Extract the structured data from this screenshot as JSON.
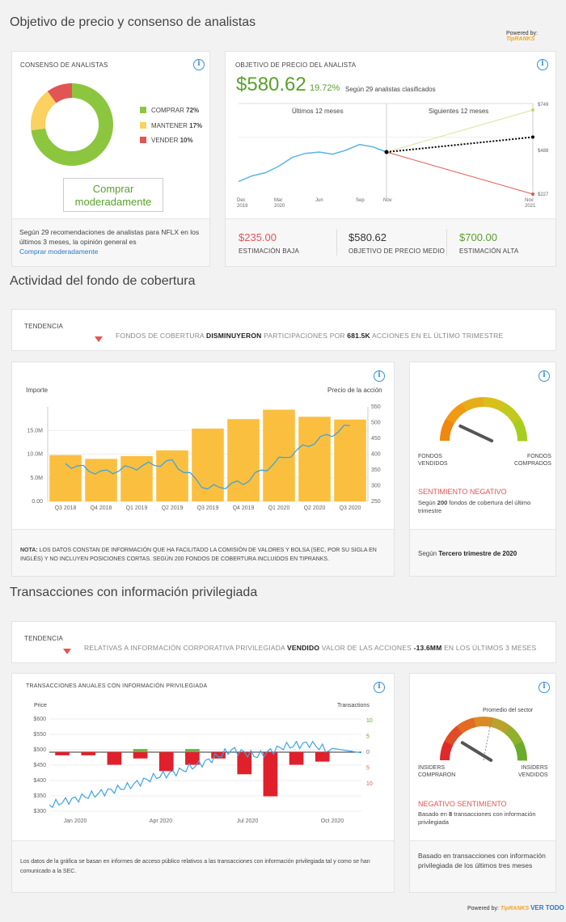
{
  "sections": {
    "price_target_title": "Objetivo de precio y consenso de analistas",
    "hedge_title": "Actividad del fondo de cobertura",
    "insider_title": "Transacciones con información privilegiada"
  },
  "powered_by": "Powered by:",
  "brand": "TipRANKS",
  "ver_todo": "VER TODO",
  "consensus": {
    "title": "CONSENSO DE ANALISTAS",
    "legend": [
      {
        "label": "COMPRAR",
        "pct": "72%",
        "color": "#8cc63f"
      },
      {
        "label": "MANTENER",
        "pct": "17%",
        "color": "#fbd160"
      },
      {
        "label": "VENDER",
        "pct": "10%",
        "color": "#e25555"
      }
    ],
    "rating_line1": "Comprar",
    "rating_line2": "moderadamente",
    "footer_text": "Según 29 recomendaciones de analistas para NFLX en los últimos 3 meses, la opinión general es",
    "footer_link": "Comprar moderadamente"
  },
  "price_target": {
    "title": "OBJETIVO DE PRECIO DEL ANALISTA",
    "price": "$580.62",
    "pct": "19.72%",
    "sub": "Según 29 analistas clasificados",
    "past_label": "Últimos 12 meses",
    "next_label": "Siguientes 12 meses",
    "right_labels": [
      "$749",
      "$488",
      "$227"
    ],
    "x_labels": [
      [
        "Dec",
        "2019"
      ],
      [
        "Mar",
        "2020"
      ],
      [
        "Jun",
        ""
      ],
      [
        "Sep",
        ""
      ],
      [
        "Nov",
        ""
      ],
      [
        "Nov",
        "2021"
      ]
    ],
    "estimates": [
      {
        "value": "$235.00",
        "label": "ESTIMACIÓN BAJA",
        "color": "#e25555"
      },
      {
        "value": "$580.62",
        "label": "OBJETIVO DE PRECIO MEDIO",
        "color": "#333333"
      },
      {
        "value": "$700.00",
        "label": "ESTIMACIÓN ALTA",
        "color": "#5aa02c"
      }
    ]
  },
  "hedge_trend": {
    "label": "TENDENCIA",
    "text_pre": "FONDOS DE COBERTURA",
    "text_bold": "DISMINUYERON",
    "text_mid": "PARTICIPACIONES POR",
    "text_bold2": "681.5K",
    "text_post": "ACCIONES EN EL ÚLTIMO TRIMESTRE"
  },
  "hedge_chart": {
    "left_title": "Importe",
    "right_title": "Precio de la acción",
    "left_ticks": [
      "15.0M",
      "10.0M",
      "5.0M",
      "0.00"
    ],
    "right_ticks": [
      "550",
      "500",
      "450",
      "400",
      "350",
      "300",
      "250"
    ],
    "note_bold": "NOTA:",
    "note_text": "LOS DATOS CONSTAN DE INFORMACIÓN QUE HA FACILITADO LA COMISIÓN DE VALORES Y BOLSA (SEC, POR SU SIGLA EN INGLÉS) Y NO INCLUYEN POSICIONES CORTAS. SEGÚN 200 FONDOS DE COBERTURA INCLUIDOS EN TIPRANKS."
  },
  "hedge_gauge": {
    "left_label1": "FONDOS",
    "left_label2": "VENDIDOS",
    "right_label1": "FONDOS",
    "right_label2": "COMPRADOS",
    "sentiment": "SENTIMIENTO NEGATIVO",
    "desc_pre": "Según",
    "desc_bold": "200",
    "desc_post": "fondos de cobertura del último trimestre",
    "footer_pre": "Según",
    "footer_bold": "Tercero trimestre de 2020"
  },
  "insider_trend": {
    "label": "TENDENCIA",
    "text_pre": "RELATIVAS A INFORMACIÓN CORPORATIVA PRIVILEGIADA",
    "text_bold": "VENDIDO",
    "text_mid": "VALOR DE LAS ACCIONES",
    "text_bold2": "-13.6MM",
    "text_post": "EN LOS ÚLTIMOS 3 MESES"
  },
  "insider_chart": {
    "title": "TRANSACCIONES ANUALES CON INFORMACIÓN PRIVILEGIADA",
    "left_title": "Price",
    "right_title": "Transactions",
    "left_ticks": [
      "$600",
      "$550",
      "$500",
      "$450",
      "$400",
      "$350",
      "$300"
    ],
    "right_ticks": [
      "10",
      "5",
      "0",
      "5",
      "10"
    ],
    "x_labels": [
      "Jan 2020",
      "Apr 2020",
      "Jul 2020",
      "Oct 2020"
    ],
    "footer": "Los datos de la gráfica se basan en informes de acceso público relativos a las transacciones con información privilegiada tal y como se han comunicado a la SEC."
  },
  "insider_gauge": {
    "sector_label": "Promedio del sector",
    "left_label1": "INSIDERS",
    "left_label2": "COMPRARON",
    "right_label1": "INSIDERS",
    "right_label2": "VENDIDOS",
    "sentiment": "NEGATIVO SENTIMIENTO",
    "desc_pre": "Basado en",
    "desc_bold": "8",
    "desc_post": "transacciones con información privilegiada",
    "footer": "Basado en transacciones con información privilegiada de los últimos tres meses"
  },
  "chart_data": [
    {
      "type": "pie",
      "title": "CONSENSO DE ANALISTAS",
      "categories": [
        "COMPRAR",
        "MANTENER",
        "VENDER"
      ],
      "values": [
        72,
        17,
        10
      ]
    },
    {
      "type": "line",
      "title": "OBJETIVO DE PRECIO DEL ANALISTA",
      "x": [
        "Dec 2019",
        "Mar 2020",
        "Jun",
        "Sep",
        "Nov",
        "Nov 2021"
      ],
      "series": [
        {
          "name": "",
          "values": [
            305,
            340,
            360,
            400,
            455,
            480,
            488,
            475,
            500,
            535,
            520,
            488
          ]
        }
      ],
      "targets": {
        "high": 749,
        "average": 580.62,
        "low": 227
      },
      "ylim": [
        227,
        749
      ]
    },
    {
      "type": "bar",
      "categories": [
        "Q3 2018",
        "Q4 2018",
        "Q1 2019",
        "Q2 2019",
        "Q3 2019",
        "Q4 2019",
        "Q1 2020",
        "Q2 2020",
        "Q3 2020"
      ],
      "series": [
        {
          "name": "Importe",
          "values": [
            9.8,
            9.0,
            9.6,
            10.8,
            15.4,
            17.4,
            19.4,
            17.9,
            17.3
          ]
        },
        {
          "name": "Precio de la acción",
          "values": [
            370,
            340,
            360,
            375,
            290,
            310,
            380,
            440,
            490
          ]
        }
      ],
      "ylim": [
        0,
        20
      ],
      "y2lim": [
        250,
        550
      ],
      "xlabel": "",
      "ylabel": "Importe"
    },
    {
      "type": "bar",
      "title": "TRANSACCIONES ANUALES CON INFORMACIÓN PRIVILEGIADA",
      "x_labels": [
        "Jan 2020",
        "Apr 2020",
        "Jul 2020",
        "Oct 2020"
      ],
      "series": [
        {
          "name": "Buy",
          "values": [
            0,
            0,
            0,
            1,
            0,
            1,
            0,
            0,
            0,
            0,
            0,
            0
          ]
        },
        {
          "name": "Sell",
          "values": [
            1,
            1,
            4,
            2,
            6,
            4,
            2,
            7,
            14,
            4,
            3,
            0
          ]
        },
        {
          "name": "Price",
          "values": [
            320,
            340,
            360,
            380,
            410,
            430,
            460,
            500,
            480,
            510,
            520,
            490
          ]
        }
      ],
      "ylim": [
        300,
        600
      ],
      "y2lim": [
        -10,
        10
      ]
    }
  ]
}
